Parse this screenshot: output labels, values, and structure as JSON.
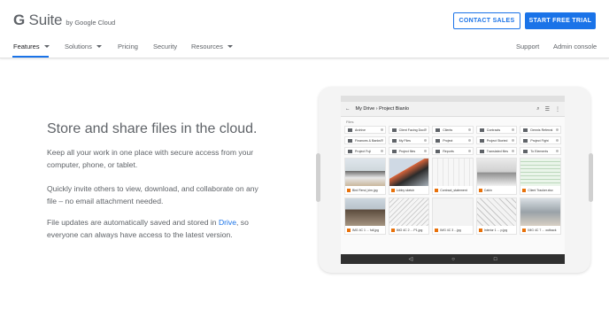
{
  "header": {
    "logo_main": "G Suite",
    "logo_sub": "by Google Cloud",
    "contact_sales": "CONTACT SALES",
    "start_trial": "START FREE TRIAL"
  },
  "nav": {
    "features": "Features",
    "solutions": "Solutions",
    "pricing": "Pricing",
    "security": "Security",
    "resources": "Resources",
    "support": "Support",
    "admin_console": "Admin console"
  },
  "hero": {
    "title": "Store and share files in the cloud.",
    "p1": "Keep all your work in one place with secure access from your computer, phone, or tablet.",
    "p2": "Quickly invite others to view, download, and collaborate on any file – no email attachment needed.",
    "p3_before": "File updates are automatically saved and stored in ",
    "p3_link": "Drive",
    "p3_after": ", so everyone can always have access to the latest version."
  },
  "tablet": {
    "breadcrumb": "My Drive  ›  Project Bianlo",
    "section_label": "Files",
    "folders": [
      "Archive",
      "Client Facing Docs",
      "Clients",
      "Contracts",
      "Dennis Referral",
      "Finances & Banks",
      "My Files",
      "Project",
      "Project Storied",
      "Project Fight",
      "Project Fuji",
      "Project files",
      "Reports",
      "Translated files",
      "To Elements"
    ],
    "files": [
      "Bird Rend_kim.jpg",
      "Lobby sketch",
      "Contract_statement",
      "Cabin",
      "Client Tracker.xlsx",
      "IMG 4C 1 ... full.jpg",
      "IMG 4C 2 ... P1.jpg",
      "IMG 4C 3 ...jpg",
      "Interior 1 ... p.jpg",
      "IMG 4C 7 ... outback"
    ],
    "colors": {
      "brand_blue": "#1a73e8",
      "icon_orange": "#e8710a"
    }
  }
}
